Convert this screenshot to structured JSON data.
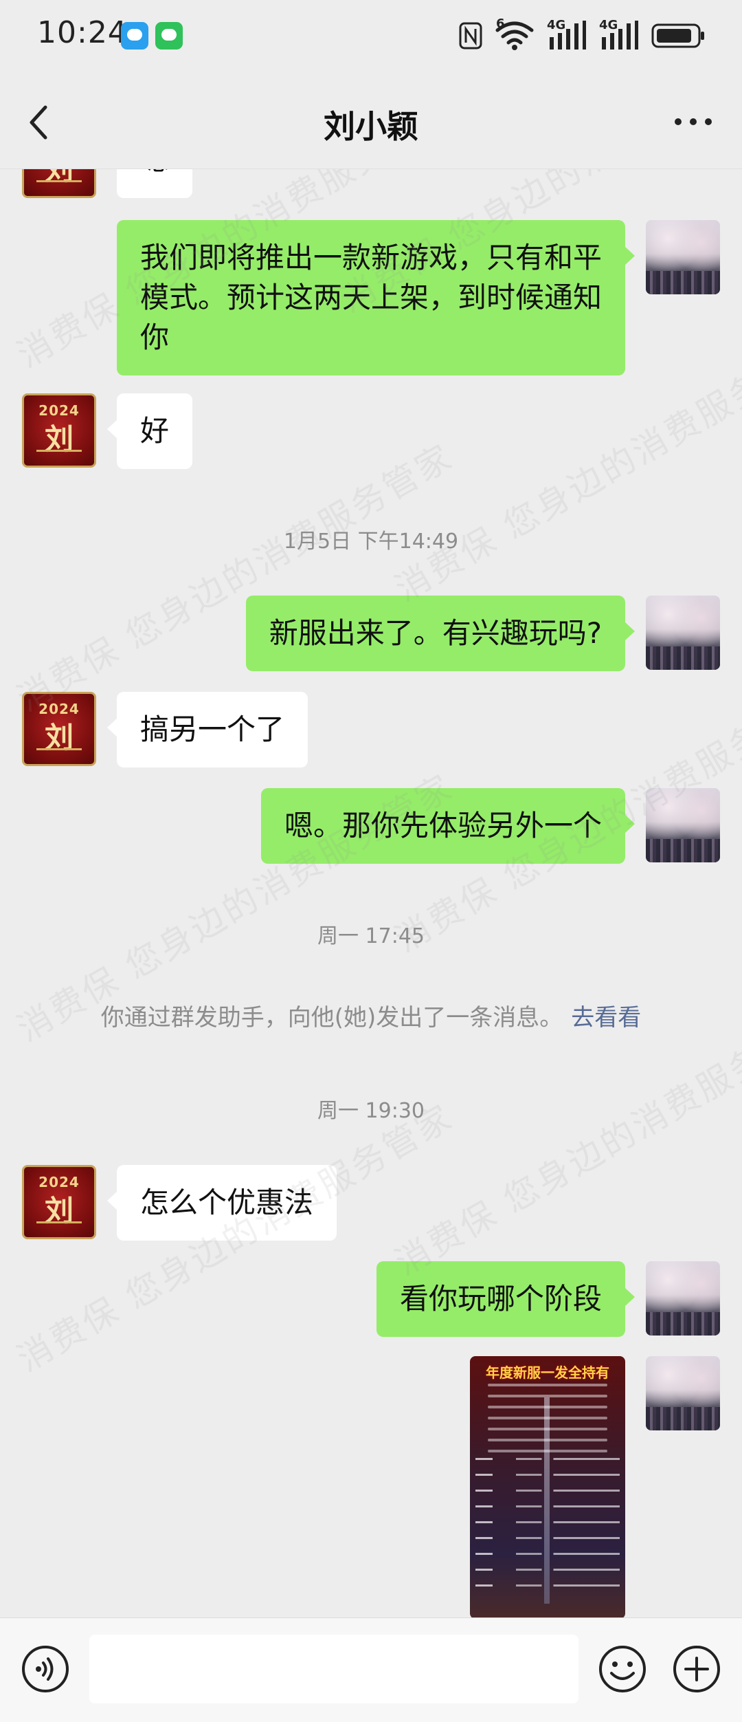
{
  "status_bar": {
    "time": "10:24",
    "network_label_1": "4G",
    "network_label_2": "4G",
    "wifi_label": "6",
    "icons": [
      "qq-icon",
      "wechat-icon",
      "nfc-icon",
      "wifi-icon",
      "signal-icon",
      "signal-icon",
      "battery-icon"
    ]
  },
  "header": {
    "title": "刘小颖",
    "back_icon": "chevron-left-icon",
    "more_icon": "more-dots-icon"
  },
  "messages": {
    "partial_top": "嗯",
    "m1": "我们即将推出一款新游戏，只有和平模式。预计这两天上架，到时候通知你",
    "m2": "好",
    "ts1": "1月5日 下午14:49",
    "m3": "新服出来了。有兴趣玩吗?",
    "m4": "搞另一个了",
    "m5": "嗯。那你先体验另外一个",
    "ts2": "周一 17:45",
    "system_text": "你通过群发助手，向他(她)发出了一条消息。",
    "system_link": "去看看",
    "ts3": "周一 19:30",
    "m6": "怎么个优惠法",
    "m7": "看你玩哪个阶段"
  },
  "avatars": {
    "contact_year": "2024",
    "contact_char": "刘"
  },
  "image_message": {
    "title": "年度新服一发全持有"
  },
  "watermark": {
    "text": "消费保 您身边的消费服务管家"
  },
  "input_bar": {
    "placeholder": "",
    "voice_icon": "voice-icon",
    "emoji_icon": "emoji-icon",
    "plus_icon": "plus-icon"
  },
  "colors": {
    "background": "#ededed",
    "bubble_sent": "#95ec69",
    "bubble_received": "#ffffff",
    "link": "#576b95",
    "timestamp": "#8c8c8c"
  }
}
